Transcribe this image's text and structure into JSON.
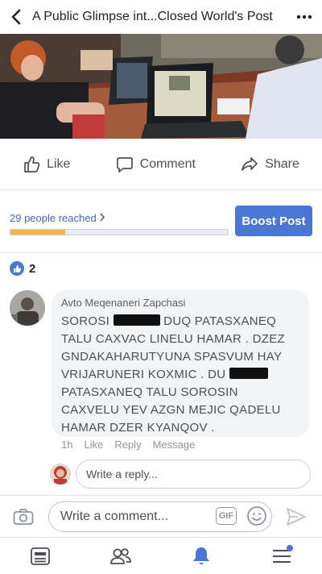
{
  "header": {
    "title": "A Public Glimpse int...Closed World's Post"
  },
  "actions": {
    "like": "Like",
    "comment": "Comment",
    "share": "Share"
  },
  "reach": {
    "text": "29 people reached",
    "progress_fraction": 0.25,
    "boost_label": "Boost Post"
  },
  "likes": {
    "count": "2"
  },
  "comment": {
    "author": "Avto Meqenaneri Zapchasi",
    "line1_a": "SOROSI ",
    "line1_b": " DUQ PATASXANEQ",
    "line2": "TALU CAXVAC LINELU HAMAR . DZEZ",
    "line3": "GNDAKAHARUTYUNA SPASVUM HAY",
    "line4_a": "VRIJARUNERI KOXMIC . DU ",
    "line5": "PATASXANEQ TALU SOROSIN",
    "line6": "CAXVELU YEV AZGN MEJIC QADELU",
    "line7": "HAMAR DZER KYANQOV .",
    "time": "1h",
    "like": "Like",
    "reply": "Reply",
    "message": "Message"
  },
  "reply": {
    "placeholder": "Write a reply..."
  },
  "composer": {
    "placeholder": "Write a comment...",
    "gif": "GIF"
  },
  "colors": {
    "accent": "#4a76d4",
    "progress": "#f6b24f"
  }
}
